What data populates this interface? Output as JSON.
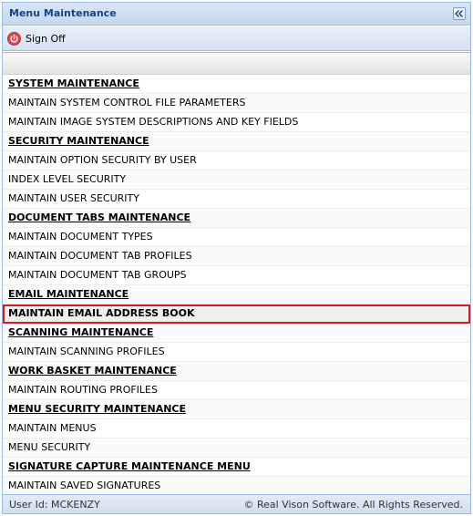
{
  "header": {
    "title": "Menu Maintenance"
  },
  "toolbar": {
    "signoff_label": "Sign Off"
  },
  "menu": [
    {
      "label": "SYSTEM MAINTENANCE",
      "type": "section"
    },
    {
      "label": "MAINTAIN SYSTEM CONTROL FILE PARAMETERS",
      "type": "item"
    },
    {
      "label": "MAINTAIN IMAGE SYSTEM DESCRIPTIONS AND KEY FIELDS",
      "type": "item"
    },
    {
      "label": "SECURITY MAINTENANCE",
      "type": "section"
    },
    {
      "label": "MAINTAIN OPTION SECURITY BY USER",
      "type": "item"
    },
    {
      "label": "INDEX LEVEL SECURITY",
      "type": "item"
    },
    {
      "label": "MAINTAIN USER SECURITY",
      "type": "item"
    },
    {
      "label": "DOCUMENT TABS MAINTENANCE",
      "type": "section"
    },
    {
      "label": "MAINTAIN DOCUMENT TYPES",
      "type": "item"
    },
    {
      "label": "MAINTAIN DOCUMENT TAB PROFILES",
      "type": "item"
    },
    {
      "label": "MAINTAIN DOCUMENT TAB GROUPS",
      "type": "item"
    },
    {
      "label": "EMAIL MAINTENANCE",
      "type": "section"
    },
    {
      "label": "MAINTAIN EMAIL ADDRESS BOOK",
      "type": "item",
      "selected": true
    },
    {
      "label": "SCANNING MAINTENANCE",
      "type": "section"
    },
    {
      "label": "MAINTAIN SCANNING PROFILES",
      "type": "item"
    },
    {
      "label": "WORK BASKET MAINTENANCE",
      "type": "section"
    },
    {
      "label": "MAINTAIN ROUTING PROFILES",
      "type": "item"
    },
    {
      "label": "MENU SECURITY MAINTENANCE",
      "type": "section"
    },
    {
      "label": "MAINTAIN MENUS",
      "type": "item"
    },
    {
      "label": "MENU SECURITY",
      "type": "item"
    },
    {
      "label": "SIGNATURE CAPTURE MAINTENANCE MENU",
      "type": "section"
    },
    {
      "label": "MAINTAIN SAVED SIGNATURES",
      "type": "item"
    }
  ],
  "footer": {
    "user": "User Id: MCKENZY",
    "copyright": "© Real Vison Software. All Rights Reserved."
  },
  "colors": {
    "header_text": "#15428b",
    "selection_border": "#d71e1e",
    "power_icon": "#e0474c"
  },
  "icons": {
    "signoff": "power-icon",
    "collapse": "double-chevron-left-icon"
  }
}
